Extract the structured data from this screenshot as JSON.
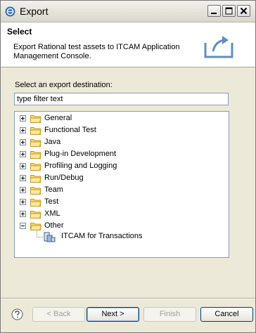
{
  "window": {
    "title": "Export",
    "icon": "eclipse-icon"
  },
  "title_buttons": [
    "minimize-icon",
    "maximize-icon",
    "close-icon"
  ],
  "header": {
    "title": "Select",
    "description": "Export Rational test assets to ITCAM Application Management Console.",
    "icon": "export-wizard-icon"
  },
  "destination": {
    "label": "Select an export destination:",
    "filter_value": "type filter text"
  },
  "tree": {
    "items": [
      {
        "label": "General",
        "expanded": false
      },
      {
        "label": "Functional Test",
        "expanded": false
      },
      {
        "label": "Java",
        "expanded": false
      },
      {
        "label": "Plug-in Development",
        "expanded": false
      },
      {
        "label": "Profiling and Logging",
        "expanded": false
      },
      {
        "label": "Run/Debug",
        "expanded": false
      },
      {
        "label": "Team",
        "expanded": false
      },
      {
        "label": "Test",
        "expanded": false
      },
      {
        "label": "XML",
        "expanded": false
      },
      {
        "label": "Other",
        "expanded": true
      }
    ],
    "child": {
      "label": "ITCAM for Transactions",
      "icon": "itcam-icon"
    }
  },
  "buttons": {
    "back": "< Back",
    "next": "Next >",
    "finish": "Finish",
    "cancel": "Cancel"
  }
}
